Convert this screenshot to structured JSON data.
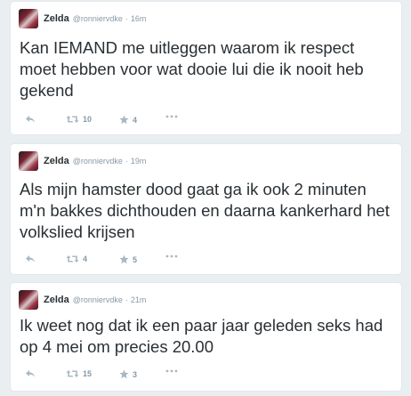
{
  "tweets": [
    {
      "name": "Zelda",
      "handle": "@ronniervdke",
      "separator": "·",
      "time": "16m",
      "text": "Kan IEMAND me uitleggen waarom ik respect moet hebben voor wat dooie lui die ik nooit heb gekend",
      "retweets": "10",
      "favorites": "4",
      "icons": {
        "reply": "reply-icon",
        "retweet": "retweet-icon",
        "favorite": "star-icon",
        "more": "more-icon"
      }
    },
    {
      "name": "Zelda",
      "handle": "@ronniervdke",
      "separator": "·",
      "time": "19m",
      "text": "Als mijn hamster dood gaat ga ik ook 2 minuten m'n bakkes dichthouden en daarna kankerhard het volkslied krijsen",
      "retweets": "4",
      "favorites": "5",
      "icons": {
        "reply": "reply-icon",
        "retweet": "retweet-icon",
        "favorite": "star-icon",
        "more": "more-icon"
      }
    },
    {
      "name": "Zelda",
      "handle": "@ronniervdke",
      "separator": "·",
      "time": "21m",
      "text": "Ik weet nog dat ik een paar jaar geleden seks had op 4 mei om precies 20.00",
      "retweets": "15",
      "favorites": "3",
      "icons": {
        "reply": "reply-icon",
        "retweet": "retweet-icon",
        "favorite": "star-icon",
        "more": "more-icon"
      }
    }
  ],
  "colors": {
    "background": "#e9eef1",
    "card": "#ffffff",
    "text": "#292f33",
    "muted": "#8899a6",
    "icon": "#aab8c2"
  }
}
